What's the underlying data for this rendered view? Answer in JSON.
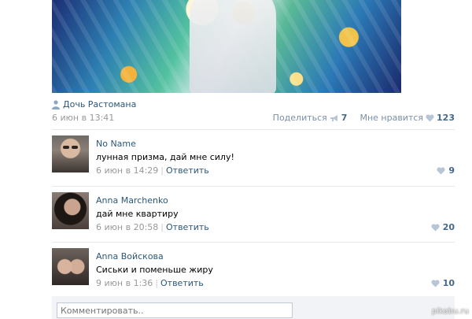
{
  "post": {
    "author": "Дочь Растомана",
    "date": "6 июн в 13:41",
    "share_label": "Поделиться",
    "share_count": "7",
    "like_label": "Мне нравится",
    "like_count": "123"
  },
  "comments": [
    {
      "name": "No Name",
      "text": "лунная призма, дай мне силу!",
      "date": "6 июн в 14:29",
      "reply": "Ответить",
      "likes": "9"
    },
    {
      "name": "Anna Marchenko",
      "text": "дай мне квартиру",
      "date": "6 июн в 20:58",
      "reply": "Ответить",
      "likes": "20"
    },
    {
      "name": "Anna Войскова",
      "text": "Сиськи и поменьше жиру",
      "date": "9 июн в 1:36",
      "reply": "Ответить",
      "likes": "10"
    }
  ],
  "reply_box": {
    "placeholder": "Комментировать.."
  },
  "watermark": "pikabu.ru",
  "colors": {
    "link": "#2b587a",
    "meta": "#999999",
    "count": "#45688e",
    "heart": "#b7c6d6"
  }
}
